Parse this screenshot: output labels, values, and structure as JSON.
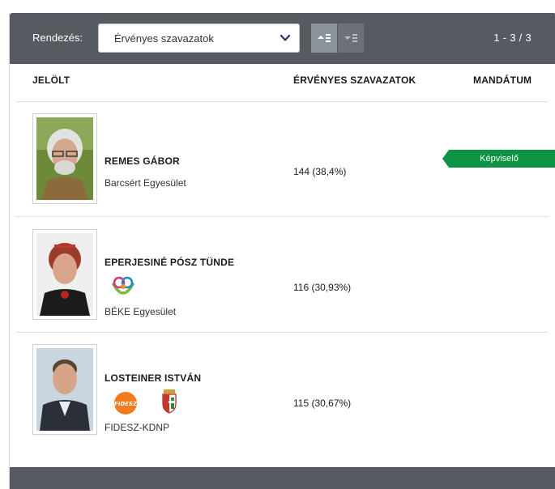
{
  "toolbar": {
    "sort_label": "Rendezés:",
    "sort_value": "Érvényes szavazatok",
    "pager": "1 - 3 / 3"
  },
  "columns": {
    "candidate": "JELÖLT",
    "votes": "ÉRVÉNYES SZAVAZATOK",
    "mandate": "MANDÁTUM"
  },
  "candidates": [
    {
      "name": "REMES GÁBOR",
      "organization": "Barcsért Egyesület",
      "votes": "144 (38,4%)",
      "mandate": "Képviselő"
    },
    {
      "name": "EPERJESINÉ PÓSZ TÜNDE",
      "organization": "BÉKE Egyesület",
      "votes": "116 (30,93%)",
      "mandate": ""
    },
    {
      "name": "LOSTEINER ISTVÁN",
      "organization": "FIDESZ-KDNP",
      "votes": "115 (30,67%)",
      "mandate": "",
      "logo_text": "FIDESZ"
    }
  ],
  "colors": {
    "toolbar_bg": "#555b61",
    "badge_green": "#0b9444",
    "fidesz_orange": "#f47a20"
  },
  "icons": {
    "sort_select": "chevron-down-icon",
    "sort_asc": "sort-ascending-icon",
    "sort_desc": "sort-descending-icon"
  }
}
